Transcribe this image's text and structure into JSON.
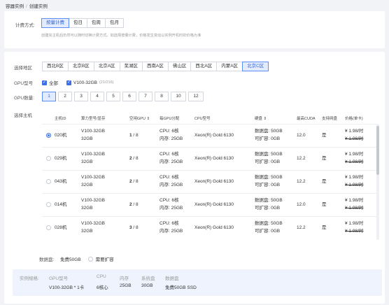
{
  "breadcrumb": {
    "parent": "容器实例",
    "separator": "/",
    "current": "创建实例"
  },
  "billing": {
    "label": "计费方式:",
    "options": [
      "按量计费",
      "包日",
      "包周",
      "包月"
    ],
    "selected": 0,
    "hint": "创建完主机后仍然可以随时切换计费方式。如选择按量计费，价格发生变动以实例开机时的价格为准"
  },
  "region": {
    "label": "选择地区",
    "options": [
      "西北B区",
      "北京B区",
      "北京A区",
      "芜湖区",
      "西南A区",
      "佛山区",
      "西北A区",
      "内蒙A区",
      "北京C区"
    ],
    "selected": 8
  },
  "gpu_type": {
    "label": "GPU型号",
    "all_label": "全部",
    "model_label": "V100-32GB",
    "model_count": "(21/216)"
  },
  "gpu_count": {
    "label": "GPU数量:",
    "options": [
      "1",
      "2",
      "3",
      "4",
      "5",
      "6",
      "7",
      "8",
      "10",
      "12"
    ],
    "selected": 0
  },
  "host": {
    "label": "选择主机",
    "headers": {
      "id": "主机ID",
      "model": "算力型号/显存",
      "free_gpu": "空闲GPU ⇕",
      "per_gpu": "每GPU分配",
      "cpu_model": "CPU型号",
      "disk": "硬盘 ⇕",
      "cuda": "最高CUDA",
      "support": "支持网盘",
      "price": "价格(单卡)"
    },
    "rows": [
      {
        "id": "020机",
        "model": "V100-32GB",
        "mem": "32GB",
        "free": "1",
        "total": " / 8",
        "cpu": "CPU:  6核",
        "ram": "内存:  25GB",
        "cpu_model": "Xeon(R) Gold 6130",
        "disk": "数据盘:  50GB",
        "expand": "可扩容:  0GB",
        "cuda": "12.0",
        "support": "是",
        "price": "¥ 1.98/时",
        "old_price": "¥ 1.98/时"
      },
      {
        "id": "029机",
        "model": "V100-32GB",
        "mem": "32GB",
        "free": "2",
        "total": " / 8",
        "cpu": "CPU:  6核",
        "ram": "内存:  25GB",
        "cpu_model": "Xeon(R) Gold 6130",
        "disk": "数据盘:  50GB",
        "expand": "可扩容:  0GB",
        "cuda": "12.2",
        "support": "是",
        "price": "¥ 1.98/时",
        "old_price": "¥ 1.98/时"
      },
      {
        "id": "043机",
        "model": "V100-32GB",
        "mem": "32GB",
        "free": "2",
        "total": " / 8",
        "cpu": "CPU:  6核",
        "ram": "内存:  25GB",
        "cpu_model": "Xeon(R) Gold 6130",
        "disk": "数据盘:  50GB",
        "expand": "可扩容:  0GB",
        "cuda": "12.2",
        "support": "是",
        "price": "¥ 1.98/时",
        "old_price": "¥ 1.98/时"
      },
      {
        "id": "014机",
        "model": "V100-32GB",
        "mem": "32GB",
        "free": "2",
        "total": " / 8",
        "cpu": "CPU:  6核",
        "ram": "内存:  25GB",
        "cpu_model": "Xeon(R) Gold 6130",
        "disk": "数据盘:  50GB",
        "expand": "可扩容:  0GB",
        "cuda": "12.0",
        "support": "是",
        "price": "¥ 1.98/时",
        "old_price": "¥ 1.98/时"
      },
      {
        "id": "028机",
        "model": "V100-32GB",
        "mem": "32GB",
        "free": "3",
        "total": " / 8",
        "cpu": "CPU:  6核",
        "ram": "内存:  25GB",
        "cpu_model": "Xeon(R) Gold 6130",
        "disk": "数据盘:  50GB",
        "expand": "可扩容:  0GB",
        "cuda": "12.2",
        "support": "是",
        "price": "¥ 1.98/时",
        "old_price": "¥ 1.98/时"
      }
    ],
    "selected": 0
  },
  "data_disk": {
    "label": "数据盘:",
    "free": "免费50GB",
    "expand_label": "需要扩容"
  },
  "summary": {
    "label": "实例规格:",
    "gpu_k": "GPU型号",
    "gpu_v": "V100-32GB * 1卡",
    "cpu_k": "CPU",
    "cpu_v": "6核心",
    "mem_k": "内存",
    "mem_v": "25GB",
    "sys_k": "系统盘",
    "sys_v": "30GB",
    "data_k": "数据盘",
    "data_v": "免费50GB SSD"
  },
  "colors": {
    "accent": "#3d6fe6",
    "price": "#e2412e",
    "summary_bg": "#eef3fd"
  }
}
